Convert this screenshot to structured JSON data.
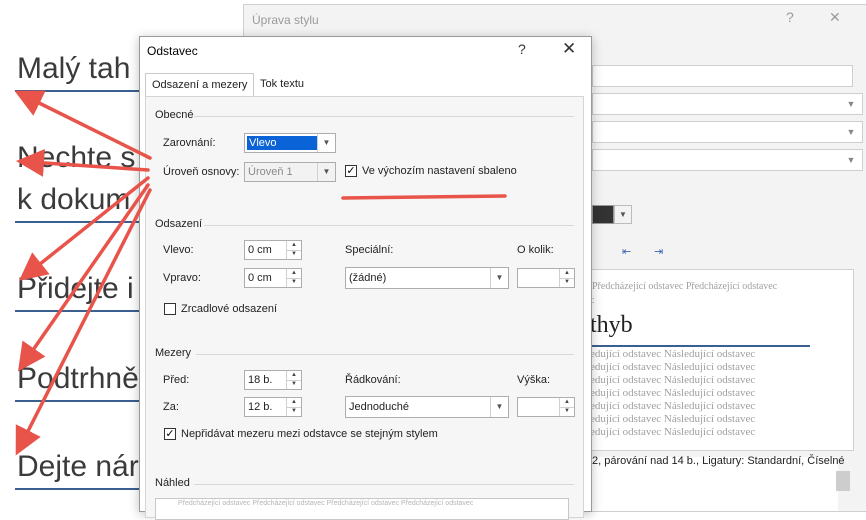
{
  "document": {
    "lines": [
      "Malý tah",
      "Nechte s",
      "k dokum",
      "Přidejte i",
      "Podtrhně",
      "Dejte nár"
    ]
  },
  "back_dialog": {
    "title": "Úprava stylu",
    "help": "?",
    "close": "✕",
    "preview_prev": "Předcházející odstavec Předcházející odstavec",
    "preview_prev2": "c",
    "preview_main": "thyb",
    "preview_next": [
      "edující odstavec Následující odstavec",
      "edující odstavec Následující odstavec",
      "edující odstavec Následující odstavec",
      "edující odstavec Následující odstavec",
      "edující odstavec Následující odstavec",
      "edující odstavec Následující odstavec",
      "edující odstavec Následující odstavec"
    ],
    "description": "2, párování nad 14 b., Ligatury: Standardní, Číselné",
    "dropdown_icon": "chevron-down-icon"
  },
  "dialog": {
    "title": "Odstavec",
    "help": "?",
    "close": "✕",
    "tabs": [
      "Odsazení a mezery",
      "Tok textu"
    ],
    "general": {
      "heading": "Obecné",
      "alignment_label": "Zarovnání:",
      "alignment_value": "Vlevo",
      "outline_label": "Úroveň osnovy:",
      "outline_value": "Úroveň 1",
      "collapsed_label": "Ve výchozím nastavení sbaleno",
      "collapsed_checked": true
    },
    "indent": {
      "heading": "Odsazení",
      "left_label": "Vlevo:",
      "left_value": "0 cm",
      "right_label": "Vpravo:",
      "right_value": "0 cm",
      "special_label": "Speciální:",
      "special_value": "(žádné)",
      "by_label": "O kolik:",
      "by_value": "",
      "mirror_label": "Zrcadlové odsazení",
      "mirror_checked": false
    },
    "spacing": {
      "heading": "Mezery",
      "before_label": "Před:",
      "before_value": "18 b.",
      "after_label": "Za:",
      "after_value": "12 b.",
      "line_label": "Řádkování:",
      "line_value": "Jednoduché",
      "at_label": "Výška:",
      "at_value": "",
      "dont_add_label": "Nepřidávat mezeru mezi odstavce se stejným stylem",
      "dont_add_checked": true
    },
    "preview": {
      "heading": "Náhled",
      "text": "Předcházející odstavec Předcházející odstavec Předcházející odstavec Předcházející odstavec"
    }
  },
  "annotation_color": "#e8534a",
  "accent_color": "#0a64d8"
}
